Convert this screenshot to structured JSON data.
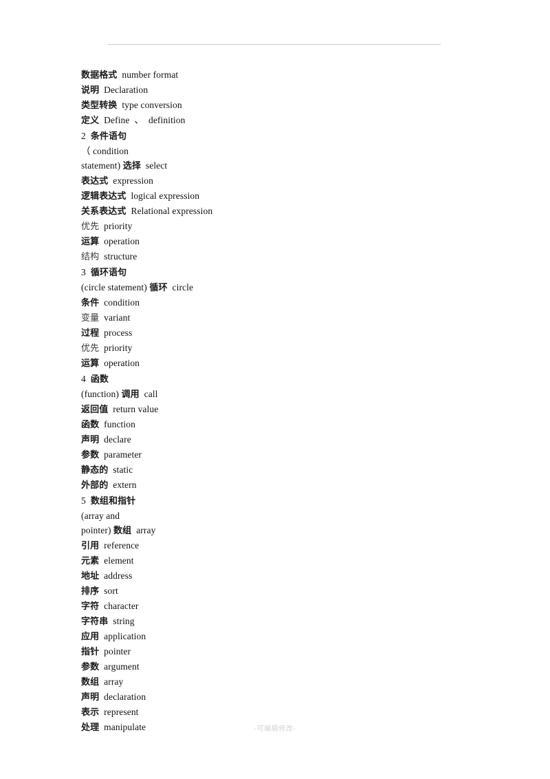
{
  "page": {
    "footer_note": "-可编辑修改-"
  },
  "content": {
    "lines": [
      {
        "cn": "数据格式",
        "en": "number format",
        "style": "bold"
      },
      {
        "cn": "说明",
        "en": "Declaration",
        "style": "mixed"
      },
      {
        "cn": "类型转换",
        "en": "type conversion",
        "style": "mixed"
      },
      {
        "cn": "定义",
        "en": "Define  、  definition",
        "style": "bold"
      },
      {
        "num": "2",
        "cn": "条件语句",
        "en": "",
        "style": "heading",
        "gap": true
      },
      {
        "cn": "",
        "en": "（ condition",
        "style": "plain"
      },
      {
        "cn": "选择",
        "en_before": "statement)",
        "en": "select",
        "style": "mixed"
      },
      {
        "cn": "表达式",
        "en": "expression",
        "style": "bold"
      },
      {
        "cn": "逻辑表达式",
        "en": "logical expression",
        "style": "mixed"
      },
      {
        "cn": "关系表达式",
        "en": "Relational expression",
        "style": "bold"
      },
      {
        "cn": "优先",
        "en": "priority",
        "style": "light"
      },
      {
        "cn": "运算",
        "en": "operation",
        "style": "bold"
      },
      {
        "cn": "结构",
        "en": "structure",
        "style": "light"
      },
      {
        "num": "3",
        "cn": "循环语句",
        "en": "",
        "style": "heading"
      },
      {
        "cn": "循环",
        "en_before": "(circle statement)",
        "en": "circle",
        "style": "mixed"
      },
      {
        "cn": "条件",
        "en": "condition",
        "style": "bold"
      },
      {
        "cn": "变量",
        "en": "variant",
        "style": "light"
      },
      {
        "cn": "过程",
        "en": "process",
        "style": "mixed"
      },
      {
        "cn": "优先",
        "en": "priority",
        "style": "light"
      },
      {
        "cn": "运算",
        "en": "operation",
        "style": "bold"
      },
      {
        "num": "4",
        "cn": "函数",
        "en": "",
        "style": "heading"
      },
      {
        "cn": "调用",
        "en_before": "(function)",
        "en": "call",
        "style": "mixed"
      },
      {
        "cn": "返回值",
        "en": "return value",
        "style": "mixed"
      },
      {
        "cn": "函数",
        "en": "function",
        "style": "bold"
      },
      {
        "cn": "声明",
        "en": "declare",
        "style": "bold"
      },
      {
        "cn": "参数",
        "en": "parameter",
        "style": "bold"
      },
      {
        "cn": "静态的",
        "en": "static",
        "style": "mixed"
      },
      {
        "cn": "外部的",
        "en": "extern",
        "style": "bold"
      },
      {
        "num": "5",
        "cn": "数组和指针",
        "en": "",
        "style": "heading"
      },
      {
        "cn": "",
        "en": "(array and",
        "style": "plain"
      },
      {
        "cn": "数组",
        "en_before": "pointer)",
        "en": "array",
        "style": "mixed"
      },
      {
        "cn": "引用",
        "en": "reference",
        "style": "bold"
      },
      {
        "cn": "元素",
        "en": "element",
        "style": "bold"
      },
      {
        "cn": "地址",
        "en": "address",
        "style": "bold"
      },
      {
        "cn": "排序",
        "en": "sort",
        "style": "bold"
      },
      {
        "cn": "字符",
        "en": "character",
        "style": "bold"
      },
      {
        "cn": "字符串",
        "en": "string",
        "style": "bold"
      },
      {
        "cn": "应用",
        "en": "application",
        "style": "mixed"
      },
      {
        "cn": "指针",
        "en": "pointer",
        "style": "mixed"
      },
      {
        "cn": "参数",
        "en": "argument",
        "style": "bold"
      },
      {
        "cn": "数组",
        "en": "array",
        "style": "mixed"
      },
      {
        "cn": "声明",
        "en": "declaration",
        "style": "bold"
      },
      {
        "cn": "表示",
        "en": "represent",
        "style": "bold"
      },
      {
        "cn": "处理",
        "en": "manipulate",
        "style": "mixed"
      }
    ]
  }
}
